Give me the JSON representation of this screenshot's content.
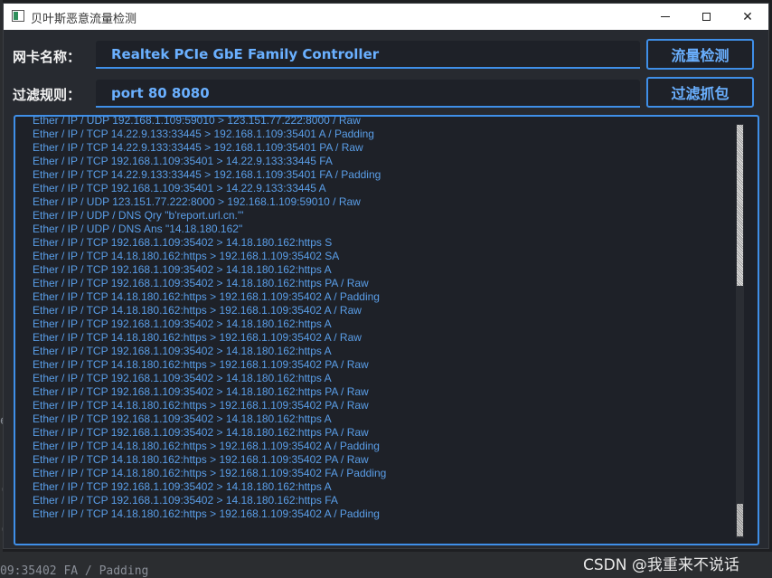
{
  "window": {
    "title": "贝叶斯恶意流量检测",
    "controls": {
      "minimize": "–",
      "maximize": "□",
      "close": "✕"
    }
  },
  "form": {
    "nic_label": "网卡名称：",
    "nic_value": "Realtek PCIe GbE Family Controller",
    "filter_label": "过滤规则：",
    "filter_value": "port 80 8080",
    "detect_button": "流量检测",
    "capture_button": "过滤抓包"
  },
  "log": [
    "Ether / IP / UDP 192.168.1.109:59010 > 123.151.77.222:8000 / Raw",
    "Ether / IP / TCP 14.22.9.133:33445 > 192.168.1.109:35401 A / Padding",
    "Ether / IP / TCP 14.22.9.133:33445 > 192.168.1.109:35401 PA / Raw",
    "Ether / IP / TCP 192.168.1.109:35401 > 14.22.9.133:33445 FA",
    "Ether / IP / TCP 14.22.9.133:33445 > 192.168.1.109:35401 FA / Padding",
    "Ether / IP / TCP 192.168.1.109:35401 > 14.22.9.133:33445 A",
    "Ether / IP / UDP 123.151.77.222:8000 > 192.168.1.109:59010 / Raw",
    "Ether / IP / UDP / DNS Qry \"b'report.url.cn.'\"",
    "Ether / IP / UDP / DNS Ans \"14.18.180.162\"",
    "Ether / IP / TCP 192.168.1.109:35402 > 14.18.180.162:https S",
    "Ether / IP / TCP 14.18.180.162:https > 192.168.1.109:35402 SA",
    "Ether / IP / TCP 192.168.1.109:35402 > 14.18.180.162:https A",
    "Ether / IP / TCP 192.168.1.109:35402 > 14.18.180.162:https PA / Raw",
    "Ether / IP / TCP 14.18.180.162:https > 192.168.1.109:35402 A / Padding",
    "Ether / IP / TCP 14.18.180.162:https > 192.168.1.109:35402 A / Raw",
    "Ether / IP / TCP 192.168.1.109:35402 > 14.18.180.162:https A",
    "Ether / IP / TCP 14.18.180.162:https > 192.168.1.109:35402 A / Raw",
    "Ether / IP / TCP 192.168.1.109:35402 > 14.18.180.162:https A",
    "Ether / IP / TCP 14.18.180.162:https > 192.168.1.109:35402 PA / Raw",
    "Ether / IP / TCP 192.168.1.109:35402 > 14.18.180.162:https A",
    "Ether / IP / TCP 192.168.1.109:35402 > 14.18.180.162:https PA / Raw",
    "Ether / IP / TCP 14.18.180.162:https > 192.168.1.109:35402 PA / Raw",
    "Ether / IP / TCP 192.168.1.109:35402 > 14.18.180.162:https A",
    "Ether / IP / TCP 192.168.1.109:35402 > 14.18.180.162:https PA / Raw",
    "Ether / IP / TCP 14.18.180.162:https > 192.168.1.109:35402 A / Padding",
    "Ether / IP / TCP 14.18.180.162:https > 192.168.1.109:35402 PA / Raw",
    "Ether / IP / TCP 14.18.180.162:https > 192.168.1.109:35402 FA / Padding",
    "Ether / IP / TCP 192.168.1.109:35402 > 14.18.180.162:https A",
    "Ether / IP / TCP 192.168.1.109:35402 > 14.18.180.162:https FA",
    "Ether / IP / TCP 14.18.180.162:https > 192.168.1.109:35402 A / Padding"
  ],
  "background": {
    "terminal_tail": "09:35402 FA / Padding",
    "left_edge_e": "e",
    "left_edge_c1": "(",
    "left_edge_c2": "("
  },
  "watermark": "CSDN @我重来不说话",
  "colors": {
    "accent": "#3f8fe8",
    "log_text": "#5a9ee8",
    "window_bg": "#272a30"
  }
}
